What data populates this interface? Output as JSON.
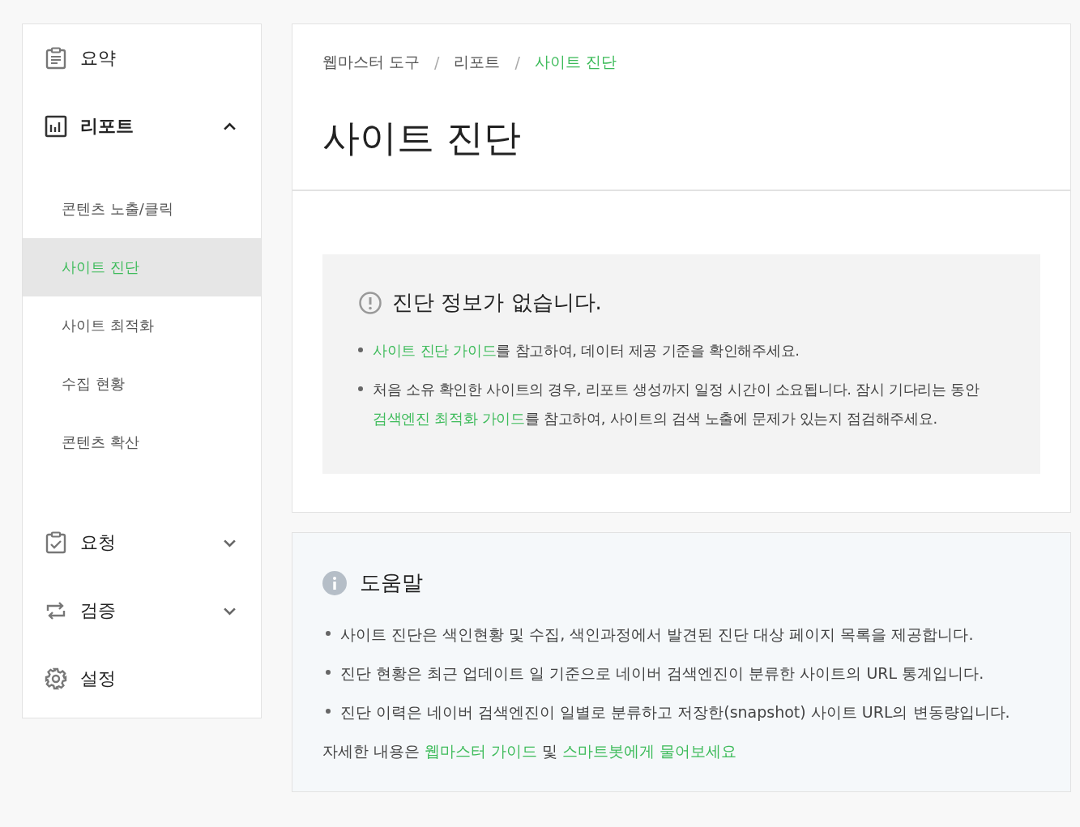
{
  "sidebar": {
    "items": [
      {
        "label": "요약"
      },
      {
        "label": "리포트",
        "expanded": true,
        "children": [
          {
            "label": "콘텐츠 노출/클릭",
            "selected": false
          },
          {
            "label": "사이트 진단",
            "selected": true
          },
          {
            "label": "사이트 최적화",
            "selected": false
          },
          {
            "label": "수집 현황",
            "selected": false
          },
          {
            "label": "콘텐츠 확산",
            "selected": false
          }
        ]
      },
      {
        "label": "요청",
        "expanded": false
      },
      {
        "label": "검증",
        "expanded": false
      },
      {
        "label": "설정"
      }
    ]
  },
  "breadcrumb": [
    {
      "label": "웹마스터 도구",
      "selected": false
    },
    {
      "label": "리포트",
      "selected": false
    },
    {
      "label": "사이트 진단",
      "selected": true
    }
  ],
  "breadcrumb_separator": "/",
  "title": "사이트 진단",
  "notice": {
    "heading": "진단 정보가 없습니다.",
    "bullets": [
      [
        {
          "text": "사이트 진단 가이드",
          "link": true
        },
        {
          "text": "를 참고하여, 데이터 제공 기준을 확인해주세요.",
          "link": false
        }
      ],
      [
        {
          "text": "처음 소유 확인한 사이트의 경우, 리포트 생성까지 일정 시간이 소요됩니다. 잠시 기다리는 동안 ",
          "link": false
        },
        {
          "text": "검색엔진 최적화 가이드",
          "link": true
        },
        {
          "text": "를 참고하여, 사이트의 검색 노출에 문제가 있는지 점검해주세요.",
          "link": false
        }
      ]
    ]
  },
  "help": {
    "heading": "도움말",
    "bullets": [
      "사이트 진단은 색인현황 및 수집, 색인과정에서 발견된 진단 대상 페이지 목록을 제공합니다.",
      "진단 현황은 최근 업데이트 일 기준으로 네이버 검색엔진이 분류한 사이트의 URL 통계입니다.",
      "진단 이력은 네이버 검색엔진이 일별로 분류하고 저장한(snapshot) 사이트 URL의 변동량입니다."
    ],
    "footer": [
      {
        "text": "자세한 내용은 ",
        "link": false
      },
      {
        "text": "웹마스터 가이드",
        "link": true
      },
      {
        "text": " 및 ",
        "link": false
      },
      {
        "text": "스마트봇에게 물어보세요",
        "link": true
      }
    ]
  }
}
